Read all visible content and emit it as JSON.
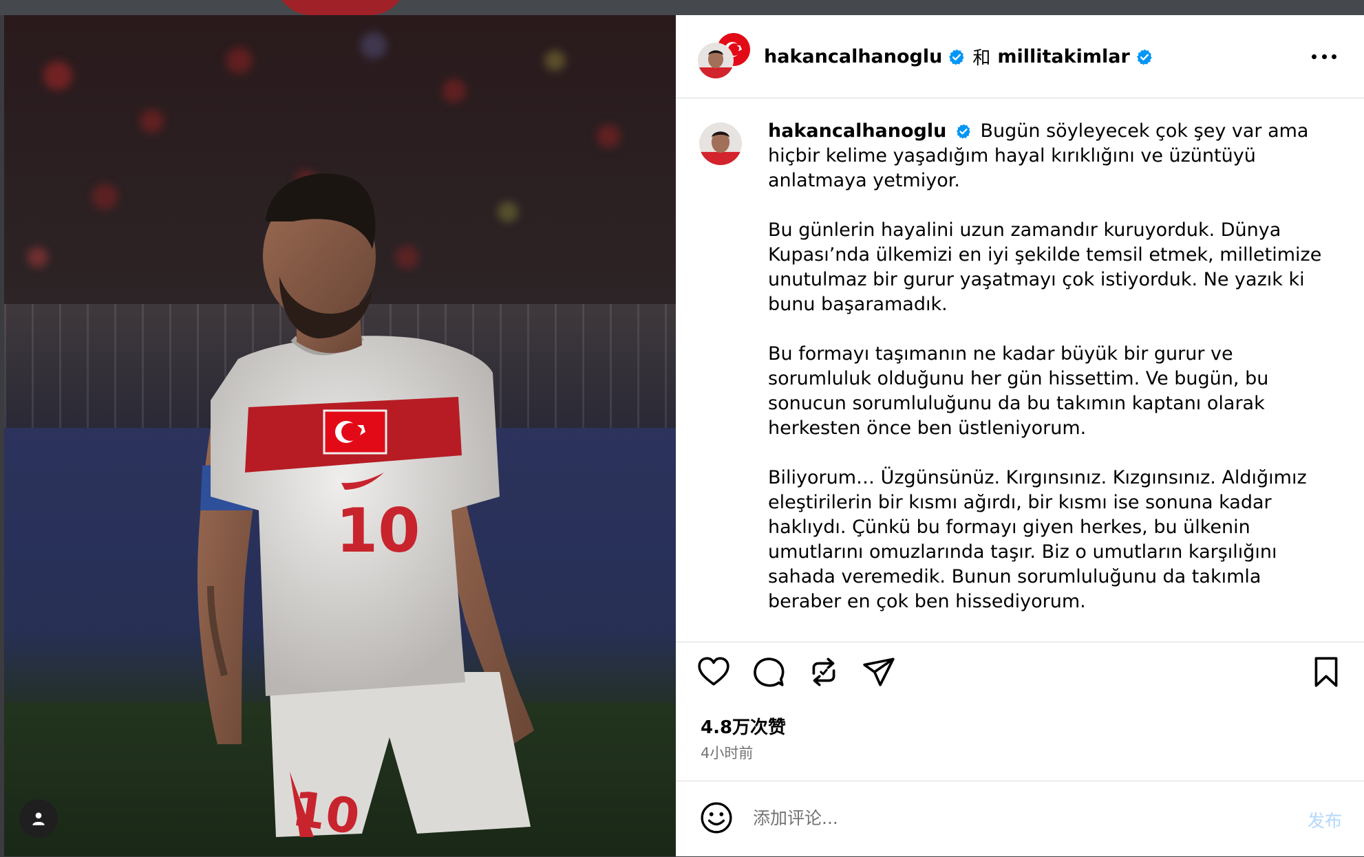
{
  "header": {
    "author": "hakancalhanoglu",
    "joiner": "和",
    "coauthor": "millitakimlar",
    "more_icon": "more-horizontal-icon"
  },
  "caption": {
    "username": "hakancalhanoglu",
    "paragraphs": [
      "Bugün söyleyecek çok şey var ama hiçbir kelime yaşadığım hayal kırıklığını ve üzüntüyü anlatmaya yetmiyor.",
      "Bu günlerin hayalini uzun zamandır kuruyorduk. Dünya Kupası’nda ülkemizi en iyi şekilde temsil etmek, milletimize unutulmaz bir gurur yaşatmayı çok istiyorduk. Ne yazık ki bunu başaramadık.",
      "Bu formayı taşımanın ne kadar büyük bir gurur ve sorumluluk olduğunu her gün hissettim. Ve bugün, bu sonucun sorumluluğunu da bu takımın kaptanı olarak herkesten önce ben üstleniyorum.",
      "Biliyorum… Üzgünsünüz. Kırgınsınız. Kızgınsınız. Aldığımız eleştirilerin bir kısmı ağırdı, bir kısmı ise sonuna kadar haklıydı. Çünkü bu formayı giyen herkes, bu ülkenin umutlarını omuzlarında taşır. Biz o umutların karşılığını sahada veremedik. Bunun sorumluluğunu da takımla beraber en çok ben hissediyorum."
    ]
  },
  "photo": {
    "jersey_number": "10",
    "user_tag_icon": "person-icon"
  },
  "actions": {
    "like_icon": "heart-icon",
    "comment_icon": "comment-icon",
    "repost_icon": "repost-icon",
    "share_icon": "send-icon",
    "save_icon": "bookmark-icon"
  },
  "stats": {
    "likes": "4.8万次赞",
    "time": "4小时前"
  },
  "comment": {
    "placeholder": "添加评论...",
    "post_label": "发布",
    "emoji_icon": "emoji-icon"
  },
  "colors": {
    "verified": "#0095f6",
    "turkey_red": "#e30a17",
    "post_disabled": "#b2d7fb",
    "secondary_text": "#737373"
  }
}
